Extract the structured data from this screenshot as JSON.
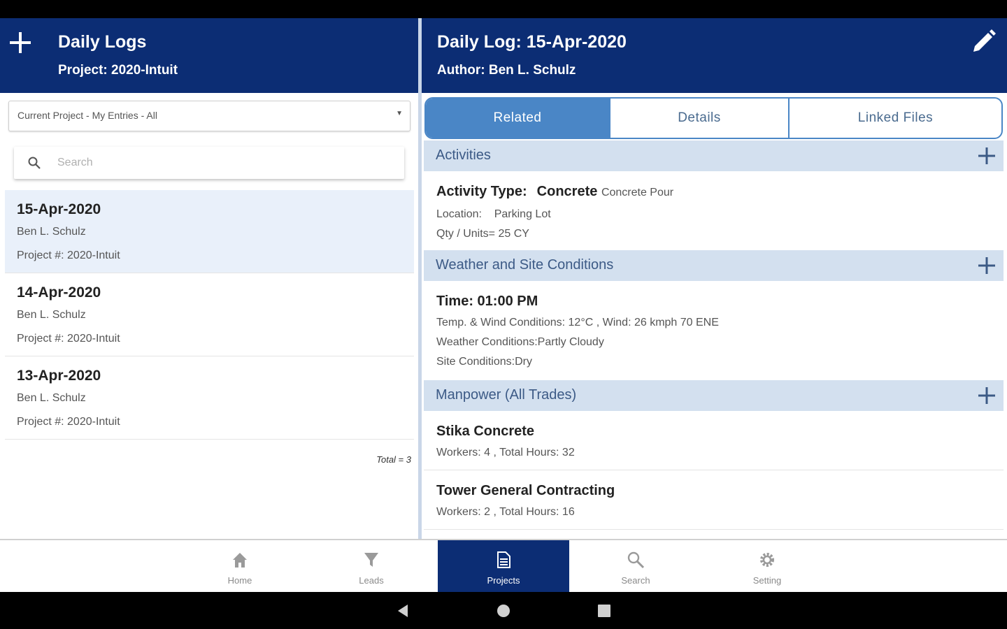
{
  "left_header": {
    "title": "Daily Logs",
    "subtitle": "Project: 2020-Intuit",
    "add_icon": "plus-icon"
  },
  "right_header": {
    "title": "Daily Log: 15-Apr-2020",
    "subtitle": "Author: Ben L. Schulz",
    "edit_icon": "pencil-icon"
  },
  "filter": {
    "value": "Current Project - My Entries - All"
  },
  "search": {
    "placeholder": "Search",
    "value": ""
  },
  "logs": [
    {
      "date": "15-Apr-2020",
      "author": "Ben L. Schulz",
      "project": "Project #: 2020-Intuit",
      "selected": true
    },
    {
      "date": "14-Apr-2020",
      "author": "Ben L. Schulz",
      "project": "Project #: 2020-Intuit",
      "selected": false
    },
    {
      "date": "13-Apr-2020",
      "author": "Ben L. Schulz",
      "project": "Project #: 2020-Intuit",
      "selected": false
    }
  ],
  "total_label": "Total = 3",
  "tabs": [
    {
      "label": "Related",
      "active": true
    },
    {
      "label": "Details",
      "active": false
    },
    {
      "label": "Linked Files",
      "active": false
    }
  ],
  "sections": {
    "activities": {
      "title": "Activities",
      "activity_type_label": "Activity Type:",
      "activity_type_value": "Concrete",
      "activity_desc": "Concrete Pour",
      "location_label": "Location:",
      "location_value": "Parking Lot",
      "qty": "Qty / Units= 25 CY"
    },
    "weather": {
      "title": "Weather and Site Conditions",
      "time": "Time: 01:00 PM",
      "temp_wind": "Temp. & Wind Conditions: 12°C , Wind: 26 kmph 70 ENE",
      "weather_conditions": "Weather Conditions:Partly Cloudy",
      "site_conditions": "Site Conditions:Dry"
    },
    "manpower": {
      "title": "Manpower (All Trades)",
      "items": [
        {
          "name": "Stika Concrete",
          "detail": "Workers: 4 , Total Hours: 32"
        },
        {
          "name": "Tower General Contracting",
          "detail": "Workers: 2 , Total Hours: 16"
        }
      ]
    }
  },
  "bottom_nav": [
    {
      "label": "Home",
      "icon": "home-icon",
      "active": false
    },
    {
      "label": "Leads",
      "icon": "funnel-icon",
      "active": false
    },
    {
      "label": "Projects",
      "icon": "document-icon",
      "active": true
    },
    {
      "label": "Search",
      "icon": "search-icon",
      "active": false
    },
    {
      "label": "Setting",
      "icon": "gear-icon",
      "active": false
    }
  ],
  "colors": {
    "header_bg": "#0c2d74",
    "tab_active": "#4a86c6",
    "section_bg": "#d3e0ef",
    "selected_row": "#e9f0fa"
  }
}
